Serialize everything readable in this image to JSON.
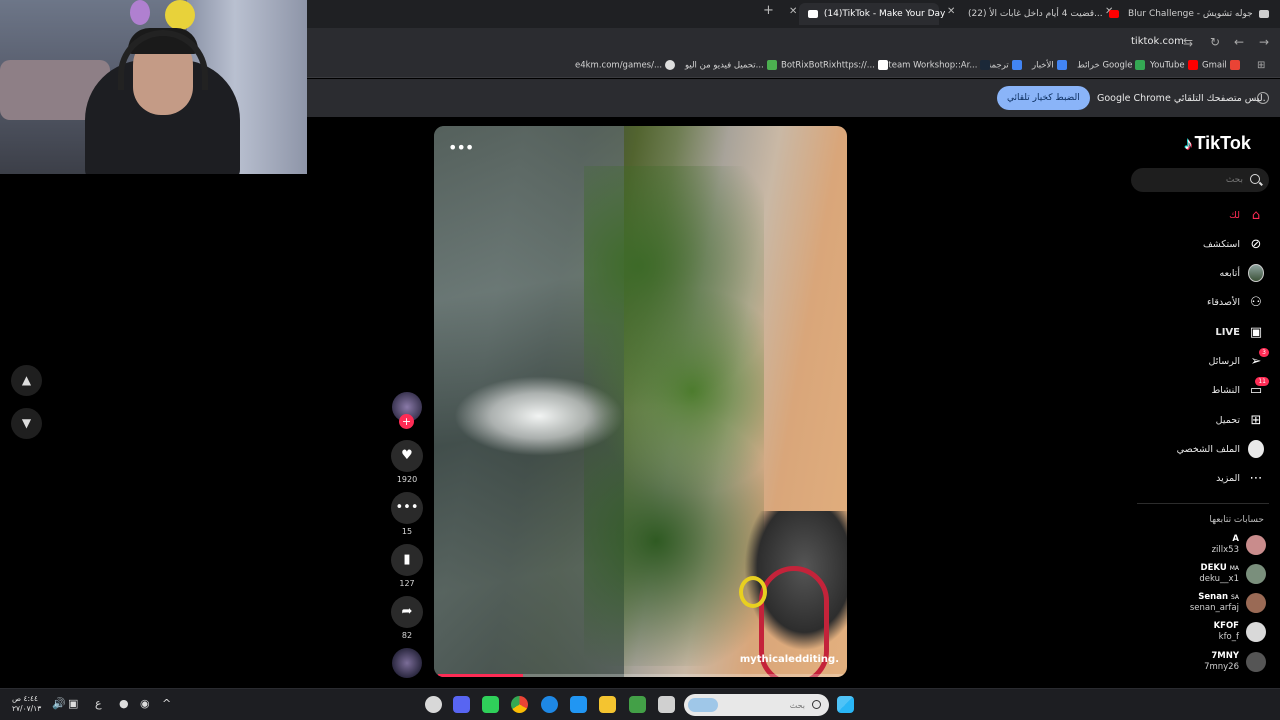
{
  "browser": {
    "tabs": [
      {
        "label": "Blur Challenge - جوله تشويش",
        "favicon_color": "#cfcfcf",
        "active": false
      },
      {
        "label": "(22) قضيت 4 أيام داخل غابات الأ...",
        "favicon_color": "#ff0000",
        "active": false
      },
      {
        "label": "(14)TikTok - Make Your Day",
        "favicon_color": "#ffffff",
        "active": true
      }
    ],
    "new_tab_label": "+",
    "url": "tiktok.com",
    "bookmarks": [
      {
        "label": "Gmail",
        "color": "#ea4335"
      },
      {
        "label": "YouTube",
        "color": "#ff0000"
      },
      {
        "label": "خرائط Google",
        "color": "#34a853"
      },
      {
        "label": "الأخبار",
        "color": "#4285f4"
      },
      {
        "label": "ترجمة",
        "color": "#4285f4"
      },
      {
        "label": "Steam Workshop::Ar...",
        "color": "#1b2838"
      },
      {
        "label": "BotRixBotRixhttps://...",
        "color": "#ffffff"
      },
      {
        "label": "تحميل فيديو من اليو...",
        "color": "#4caf50"
      },
      {
        "label": "e4km.com/games/...",
        "color": "#dddddd"
      }
    ],
    "infobar": {
      "message": "Google Chrome ليس متصفحك التلقائي.",
      "button": "الضبط كخيار تلقائي"
    }
  },
  "video": {
    "more_label": "•••",
    "watermark": "mythicaledditing.",
    "progress": 0.21
  },
  "actions": {
    "likes": "1920",
    "comments": "15",
    "saves": "127",
    "shares": "82"
  },
  "nav": {
    "up_icon": "▲",
    "down_icon": "▼"
  },
  "tiktok": {
    "logo": "TikTok",
    "search_placeholder": "بحث",
    "menu": [
      {
        "label": "لك",
        "icon": "home-icon",
        "active": true
      },
      {
        "label": "استكشف",
        "icon": "compass-icon"
      },
      {
        "label": "أتابعه",
        "icon": "following-avatar"
      },
      {
        "label": "الأصدقاء",
        "icon": "friends-icon"
      },
      {
        "label": "LIVE",
        "icon": "live-icon"
      },
      {
        "label": "الرسائل",
        "icon": "messages-icon",
        "badge": "3"
      },
      {
        "label": "النشاط",
        "icon": "activity-icon",
        "badge": "11"
      },
      {
        "label": "تحميل",
        "icon": "upload-icon"
      },
      {
        "label": "الملف الشخصي",
        "icon": "profile-avatar"
      },
      {
        "label": "المزيد",
        "icon": "more-icon"
      }
    ],
    "following_heading": "حسابات تتابعها",
    "following": [
      {
        "name": "A",
        "handle": "zillx53",
        "color": "#c98c8c"
      },
      {
        "name": "DEKU",
        "tag": "MA",
        "handle": "deku__x1",
        "color": "#7a8f7c"
      },
      {
        "name": "Senan",
        "tag": "SA",
        "handle": "senan_arfaj",
        "color": "#9a6a55"
      },
      {
        "name": "KFOF",
        "handle": "kfo_f",
        "color": "#d9d9d9"
      },
      {
        "name": "7MNY",
        "handle": "7mny26",
        "color": "#555555"
      }
    ]
  },
  "taskbar": {
    "clock_time": "٤:٤٤ ص",
    "clock_date": "٢٧/٠٧/١٣",
    "lang": "ع",
    "search_placeholder": "بحث"
  }
}
